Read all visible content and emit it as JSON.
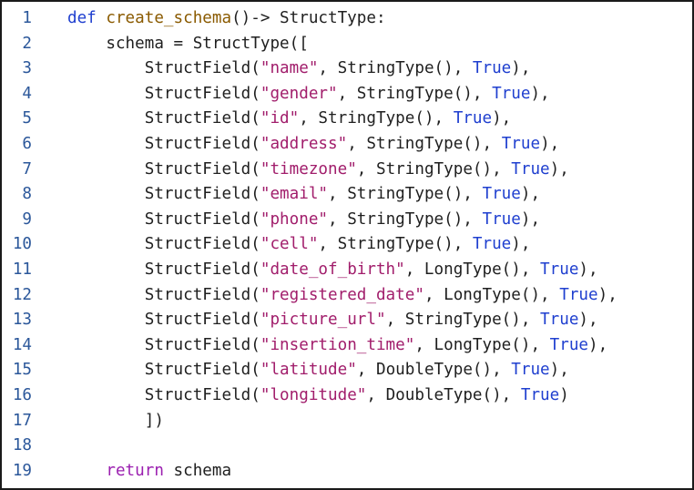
{
  "editor": {
    "lines": [
      {
        "num": "1",
        "tokens": [
          {
            "t": "def",
            "c": "kw"
          },
          {
            "t": " ",
            "c": "tx"
          },
          {
            "t": "create_schema",
            "c": "fn"
          },
          {
            "t": "()-> StructType:",
            "c": "tx"
          }
        ]
      },
      {
        "num": "2",
        "tokens": [
          {
            "t": "    schema = StructType([",
            "c": "tx"
          }
        ]
      },
      {
        "num": "3",
        "tokens": [
          {
            "t": "        StructField(",
            "c": "tx"
          },
          {
            "t": "\"name\"",
            "c": "st"
          },
          {
            "t": ", StringType(), ",
            "c": "tx"
          },
          {
            "t": "True",
            "c": "bt"
          },
          {
            "t": "),",
            "c": "tx"
          }
        ]
      },
      {
        "num": "4",
        "tokens": [
          {
            "t": "        StructField(",
            "c": "tx"
          },
          {
            "t": "\"gender\"",
            "c": "st"
          },
          {
            "t": ", StringType(), ",
            "c": "tx"
          },
          {
            "t": "True",
            "c": "bt"
          },
          {
            "t": "),",
            "c": "tx"
          }
        ]
      },
      {
        "num": "5",
        "tokens": [
          {
            "t": "        StructField(",
            "c": "tx"
          },
          {
            "t": "\"id\"",
            "c": "st"
          },
          {
            "t": ", StringType(), ",
            "c": "tx"
          },
          {
            "t": "True",
            "c": "bt"
          },
          {
            "t": "),",
            "c": "tx"
          }
        ]
      },
      {
        "num": "6",
        "tokens": [
          {
            "t": "        StructField(",
            "c": "tx"
          },
          {
            "t": "\"address\"",
            "c": "st"
          },
          {
            "t": ", StringType(), ",
            "c": "tx"
          },
          {
            "t": "True",
            "c": "bt"
          },
          {
            "t": "),",
            "c": "tx"
          }
        ]
      },
      {
        "num": "7",
        "tokens": [
          {
            "t": "        StructField(",
            "c": "tx"
          },
          {
            "t": "\"timezone\"",
            "c": "st"
          },
          {
            "t": ", StringType(), ",
            "c": "tx"
          },
          {
            "t": "True",
            "c": "bt"
          },
          {
            "t": "),",
            "c": "tx"
          }
        ]
      },
      {
        "num": "8",
        "tokens": [
          {
            "t": "        StructField(",
            "c": "tx"
          },
          {
            "t": "\"email\"",
            "c": "st"
          },
          {
            "t": ", StringType(), ",
            "c": "tx"
          },
          {
            "t": "True",
            "c": "bt"
          },
          {
            "t": "),",
            "c": "tx"
          }
        ]
      },
      {
        "num": "9",
        "tokens": [
          {
            "t": "        StructField(",
            "c": "tx"
          },
          {
            "t": "\"phone\"",
            "c": "st"
          },
          {
            "t": ", StringType(), ",
            "c": "tx"
          },
          {
            "t": "True",
            "c": "bt"
          },
          {
            "t": "),",
            "c": "tx"
          }
        ]
      },
      {
        "num": "10",
        "tokens": [
          {
            "t": "        StructField(",
            "c": "tx"
          },
          {
            "t": "\"cell\"",
            "c": "st"
          },
          {
            "t": ", StringType(), ",
            "c": "tx"
          },
          {
            "t": "True",
            "c": "bt"
          },
          {
            "t": "),",
            "c": "tx"
          }
        ]
      },
      {
        "num": "11",
        "tokens": [
          {
            "t": "        StructField(",
            "c": "tx"
          },
          {
            "t": "\"date_of_birth\"",
            "c": "st"
          },
          {
            "t": ", LongType(), ",
            "c": "tx"
          },
          {
            "t": "True",
            "c": "bt"
          },
          {
            "t": "),",
            "c": "tx"
          }
        ]
      },
      {
        "num": "12",
        "tokens": [
          {
            "t": "        StructField(",
            "c": "tx"
          },
          {
            "t": "\"registered_date\"",
            "c": "st"
          },
          {
            "t": ", LongType(), ",
            "c": "tx"
          },
          {
            "t": "True",
            "c": "bt"
          },
          {
            "t": "),",
            "c": "tx"
          }
        ]
      },
      {
        "num": "13",
        "tokens": [
          {
            "t": "        StructField(",
            "c": "tx"
          },
          {
            "t": "\"picture_url\"",
            "c": "st"
          },
          {
            "t": ", StringType(), ",
            "c": "tx"
          },
          {
            "t": "True",
            "c": "bt"
          },
          {
            "t": "),",
            "c": "tx"
          }
        ]
      },
      {
        "num": "14",
        "tokens": [
          {
            "t": "        StructField(",
            "c": "tx"
          },
          {
            "t": "\"insertion_time\"",
            "c": "st"
          },
          {
            "t": ", LongType(), ",
            "c": "tx"
          },
          {
            "t": "True",
            "c": "bt"
          },
          {
            "t": "),",
            "c": "tx"
          }
        ]
      },
      {
        "num": "15",
        "tokens": [
          {
            "t": "        StructField(",
            "c": "tx"
          },
          {
            "t": "\"latitude\"",
            "c": "st"
          },
          {
            "t": ", DoubleType(), ",
            "c": "tx"
          },
          {
            "t": "True",
            "c": "bt"
          },
          {
            "t": "),",
            "c": "tx"
          }
        ]
      },
      {
        "num": "16",
        "tokens": [
          {
            "t": "        StructField(",
            "c": "tx"
          },
          {
            "t": "\"longitude\"",
            "c": "st"
          },
          {
            "t": ", DoubleType(), ",
            "c": "tx"
          },
          {
            "t": "True",
            "c": "bt"
          },
          {
            "t": ")",
            "c": "tx"
          }
        ]
      },
      {
        "num": "17",
        "tokens": [
          {
            "t": "        ])",
            "c": "tx"
          }
        ]
      },
      {
        "num": "18",
        "tokens": []
      },
      {
        "num": "19",
        "tokens": [
          {
            "t": "    ",
            "c": "tx"
          },
          {
            "t": "return",
            "c": "rt"
          },
          {
            "t": " schema",
            "c": "tx"
          }
        ]
      }
    ]
  },
  "colors": {
    "keyword": "#1f3fcf",
    "function_name": "#8a5a00",
    "string": "#a11d6b",
    "builtin": "#1f3fcf",
    "return_keyword": "#9b1fb0",
    "text": "#1f1f1f",
    "line_number": "#2b579a",
    "border": "#1a1a1a"
  }
}
